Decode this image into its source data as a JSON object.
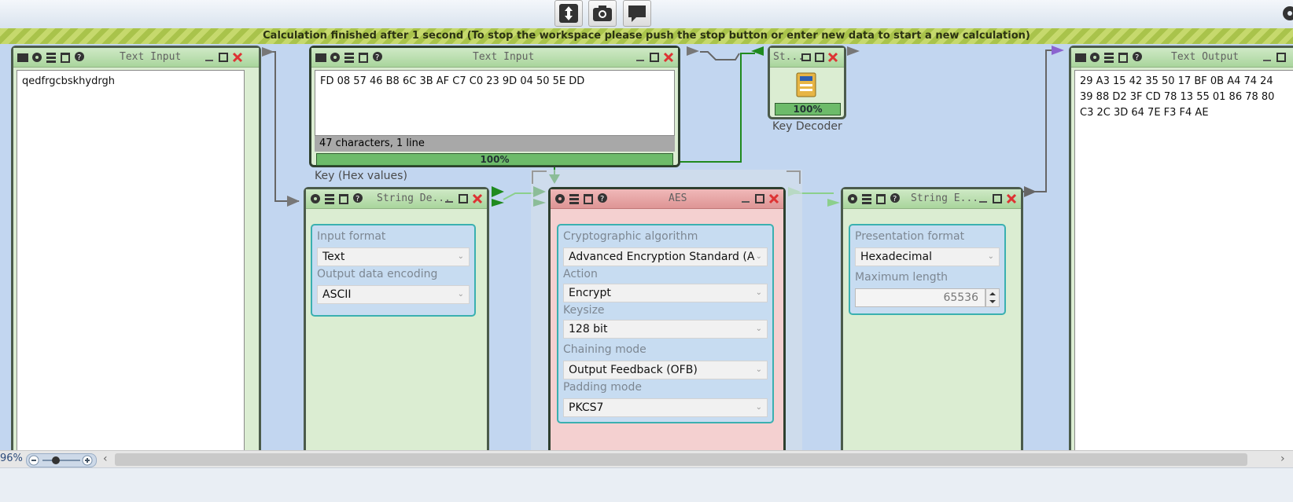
{
  "banner": {
    "text": "Calculation finished after 1 second (To stop the workspace please push the stop button or enter new data to start a new calculation)"
  },
  "toolbar": {
    "icons": [
      "fit-to-screen-icon",
      "camera-icon",
      "comment-icon",
      "settings-icon"
    ]
  },
  "panels": {
    "text_input_1": {
      "title": "Text Input",
      "content": "qedfrgcbskhydrgh"
    },
    "text_input_2": {
      "title": "Text Input",
      "content": "FD 08 57 46 B8 6C 3B AF C7 C0 23 9D 04 50 5E DD",
      "status": "47 characters,  1 line",
      "progress_label": "100%",
      "progress": 1.0,
      "caption": "Key (Hex values)"
    },
    "key_decoder": {
      "title": "St...",
      "progress_label": "100%",
      "progress": 1.0,
      "caption": "Key Decoder"
    },
    "string_decoder": {
      "title": "String De...",
      "input_format_label": "Input format",
      "input_format": "Text",
      "output_encoding_label": "Output data encoding",
      "output_encoding": "ASCII"
    },
    "aes": {
      "title": "AES",
      "algorithm_label": "Cryptographic algorithm",
      "algorithm": "Advanced Encryption Standard (A",
      "action_label": "Action",
      "action": "Encrypt",
      "keysize_label": "Keysize",
      "keysize": "128 bit",
      "chaining_label": "Chaining mode",
      "chaining": "Output Feedback (OFB)",
      "padding_label": "Padding mode",
      "padding": "PKCS7"
    },
    "string_encoder": {
      "title": "String E...",
      "presentation_label": "Presentation format",
      "presentation": "Hexadecimal",
      "maxlen_label": "Maximum length",
      "maxlen": "65536"
    },
    "text_output": {
      "title": "Text Output",
      "lines": [
        "29 A3 15 42 35 50 17 BF 0B A4 74 24",
        "39 88 D2 3F CD 78 13 55 01 86 78 80",
        "C3 2C 3D 64 7E F3 F4 AE"
      ]
    }
  },
  "zoom": {
    "label": "96%",
    "level": 0.35
  },
  "colors": {
    "panel_green": "#dbedd2",
    "panel_red": "#f4d0d0",
    "workspace": "#c2d6f0",
    "banner": "#b9ce5c"
  }
}
